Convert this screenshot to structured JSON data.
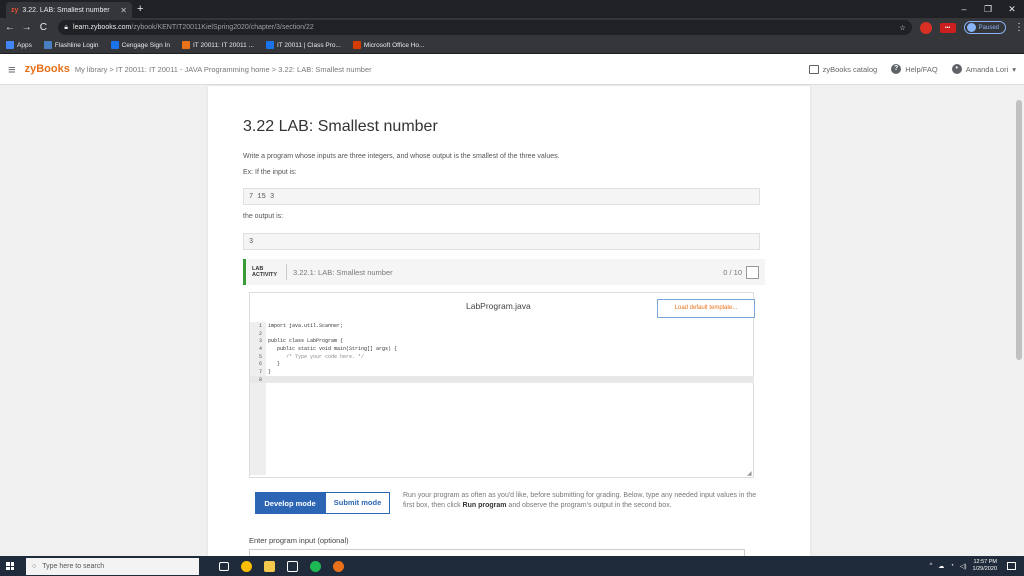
{
  "browser": {
    "tab_icon": "zy",
    "tab_title": "3.22. LAB: Smallest number",
    "new_tab": "+",
    "window_controls": [
      "–",
      "❐",
      "✕"
    ],
    "nav": {
      "back": "←",
      "forward": "→",
      "reload": "C"
    },
    "url_host": "learn.zybooks.com",
    "url_path": "/zybook/KENTIT20011KielSpring2020/chapter/3/section/22",
    "star": "☆",
    "ext_lastpass": "•••",
    "profile_status": "Paused",
    "menu": "⋮"
  },
  "bookmarks": [
    {
      "label": "Apps",
      "icon": "apps-grid",
      "color": "#4285f4"
    },
    {
      "label": "Flashline Login",
      "icon": "flashline-icon",
      "color": "#4a7fc1"
    },
    {
      "label": "Cengage Sign In",
      "icon": "cengage-icon",
      "color": "#1a73e8"
    },
    {
      "label": "IT 20011: IT 20011 ...",
      "icon": "zybooks-icon",
      "color": "#e8711a"
    },
    {
      "label": "IT 20011 | Class Pro...",
      "icon": "p-icon",
      "color": "#1a73e8"
    },
    {
      "label": "Microsoft Office Ho...",
      "icon": "office-icon",
      "color": "#d83b01"
    }
  ],
  "zybooks": {
    "logo": "zyBooks",
    "breadcrumb": "My library > IT 20011: IT 20011 - JAVA Programming home > 3.22: LAB: Smallest number",
    "catalog": "zyBooks catalog",
    "help": "Help/FAQ",
    "user": "Amanda Lori"
  },
  "content": {
    "title": "3.22 LAB: Smallest number",
    "description": "Write a program whose inputs are three integers, and whose output is the smallest of the three values.",
    "example_intro": "Ex: If the input is:",
    "example_input": "7 15 3",
    "output_intro": "the output is:",
    "example_output": "3"
  },
  "lab": {
    "tag_line1": "LAB",
    "tag_line2": "ACTIVITY",
    "title": "3.22.1: LAB: Smallest number",
    "score": "0 / 10",
    "filename": "LabProgram.java",
    "load_template": "Load default template...",
    "code_lines": [
      {
        "n": "1",
        "text": "import java.util.Scanner;"
      },
      {
        "n": "2",
        "text": ""
      },
      {
        "n": "3",
        "text": "public class LabProgram {"
      },
      {
        "n": "4",
        "text": "   public static void main(String[] args) {"
      },
      {
        "n": "5",
        "text": "      /* Type your code here. */"
      },
      {
        "n": "6",
        "text": "   }"
      },
      {
        "n": "7",
        "text": "}"
      },
      {
        "n": "8",
        "text": ""
      }
    ],
    "develop_mode": "Develop mode",
    "submit_mode": "Submit mode",
    "run_text_1": "Run your program as often as you'd like, before submitting for grading. Below, type any needed input values in the first box, then click ",
    "run_text_bold": "Run program",
    "run_text_2": " and observe the program's output in the second box.",
    "input_label": "Enter program input (optional)"
  },
  "taskbar": {
    "search_placeholder": "Type here to search",
    "time": "12:57 PM",
    "date": "1/29/2020"
  }
}
